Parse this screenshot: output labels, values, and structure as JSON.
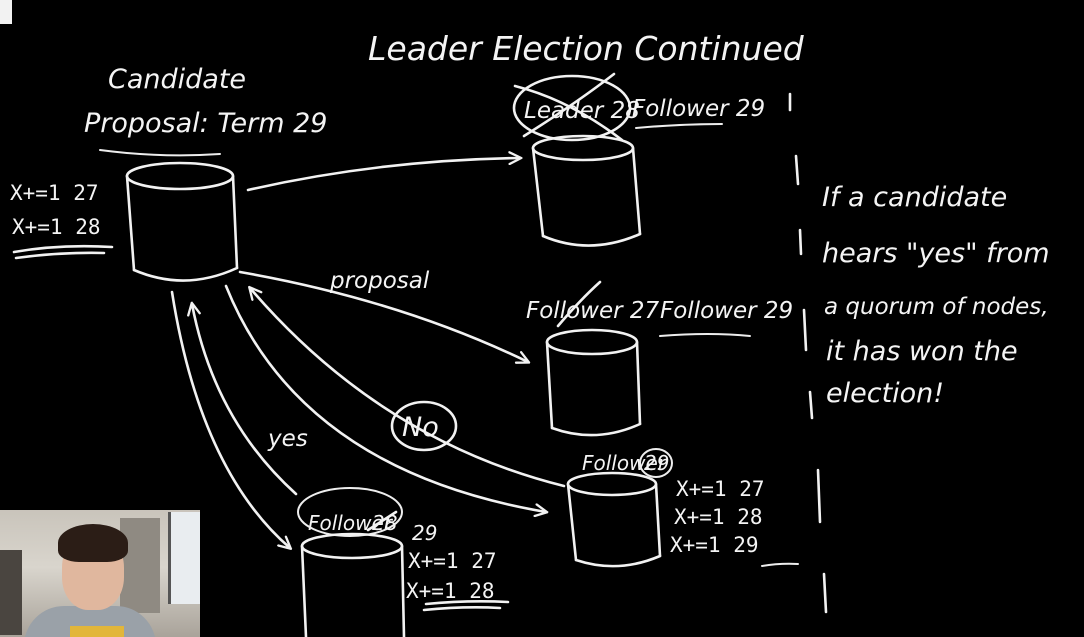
{
  "title": "Leader Election Continued",
  "candidate": {
    "label": "Candidate",
    "proposal": "Proposal: Term 29",
    "log": [
      "X+=1 27",
      "X+=1 28"
    ]
  },
  "node_top": {
    "crossed_label": "Leader 28",
    "new_label": "Follower 29"
  },
  "node_middle": {
    "crossed_label": "Follower 27",
    "new_label": "Follower 29"
  },
  "node_right": {
    "label": "Follower",
    "term": "29",
    "log": [
      "X+=1 27",
      "X+=1 28",
      "X+=1 29"
    ]
  },
  "node_bottom": {
    "label": "Follower",
    "crossed_term": "28",
    "new_term": "29",
    "log": [
      "X+=1 27",
      "X+=1 28"
    ]
  },
  "edges": {
    "proposal": "proposal",
    "yes": "yes",
    "no": "No"
  },
  "note": [
    "If a candidate",
    "hears \"yes\" from",
    "a quorum of nodes,",
    "it has won the",
    "election!"
  ],
  "colors": {
    "background": "#000000",
    "ink": "#f2f2f2"
  }
}
